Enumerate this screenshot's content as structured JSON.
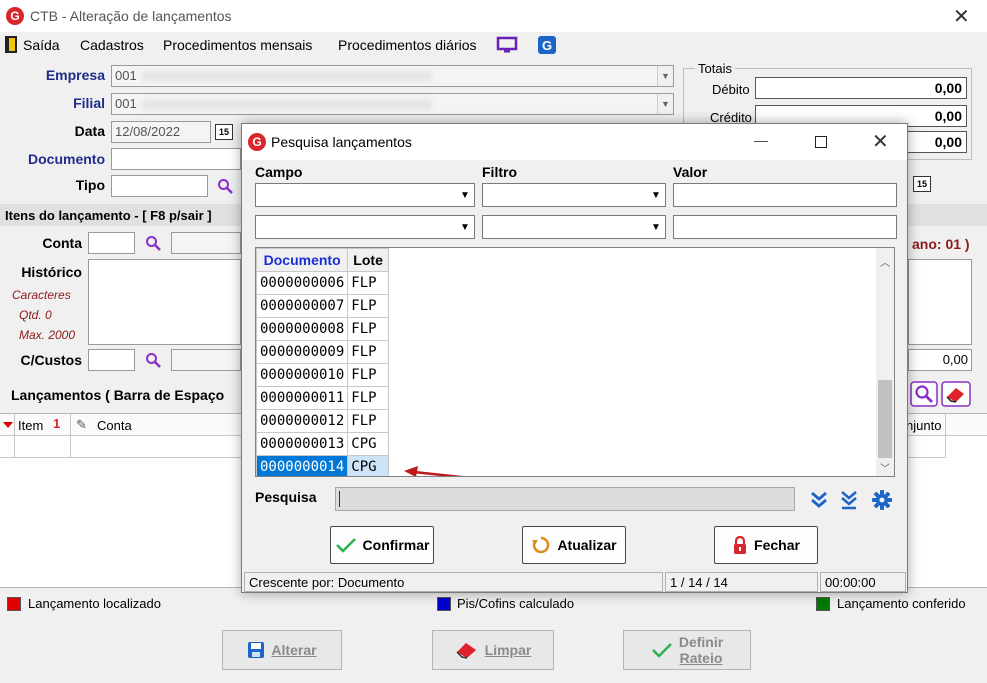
{
  "window": {
    "title": "CTB - Alteração de lançamentos",
    "close": "✕"
  },
  "menu": {
    "exit": "Saída",
    "items": [
      "Cadastros",
      "Procedimentos mensais",
      "Procedimentos diários"
    ]
  },
  "form": {
    "empresa_label": "Empresa",
    "empresa_value": "001",
    "filial_label": "Filial",
    "filial_value": "001",
    "data_label": "Data",
    "data_value": "12/08/2022",
    "documento_label": "Documento",
    "tipo_label": "Tipo",
    "calendar_icon_text": "15"
  },
  "totals": {
    "group_label": "Totais",
    "debito_label": "Débito",
    "debito_value": "0,00",
    "credito_label": "Crédito",
    "credito_value": "0,00",
    "third_value": "0,00"
  },
  "items_section": {
    "title": "Itens do lançamento - [ F8 p/sair ]",
    "conta_label": "Conta",
    "historico_label": "Histórico",
    "caracteres": "Caracteres",
    "qtd": "Qtd. 0",
    "max": "Max. 2000",
    "ccustos_label": "C/Custos",
    "right_red": "ano: 01 )",
    "right_value": "0,00"
  },
  "lancamentos": {
    "title": "Lançamentos ( Barra de Espaço",
    "col_item": "Item",
    "col_item_marker": "1",
    "col_conta": "Conta",
    "col_right": "njunto"
  },
  "legend": [
    {
      "label": "Lançamento localizado",
      "color": "#e00000"
    },
    {
      "label": "Pis/Cofins calculado",
      "color": "#0000d0"
    },
    {
      "label": "Lançamento conferido",
      "color": "#007a00"
    }
  ],
  "bottom_buttons": {
    "alterar": "Alterar",
    "limpar": "Limpar",
    "definir": "Definir",
    "rateio": "Rateio"
  },
  "dialog": {
    "title": "Pesquisa lançamentos",
    "minimize": "—",
    "maximize": "☐",
    "close": "✕",
    "campo_label": "Campo",
    "filtro_label": "Filtro",
    "valor_label": "Valor",
    "grid_headers": {
      "documento": "Documento",
      "lote": "Lote"
    },
    "rows": [
      {
        "documento": "0000000006",
        "lote": "FLP"
      },
      {
        "documento": "0000000007",
        "lote": "FLP"
      },
      {
        "documento": "0000000008",
        "lote": "FLP"
      },
      {
        "documento": "0000000009",
        "lote": "FLP"
      },
      {
        "documento": "0000000010",
        "lote": "FLP"
      },
      {
        "documento": "0000000011",
        "lote": "FLP"
      },
      {
        "documento": "0000000012",
        "lote": "FLP"
      },
      {
        "documento": "0000000013",
        "lote": "CPG"
      },
      {
        "documento": "0000000014",
        "lote": "CPG"
      }
    ],
    "selected_index": 8,
    "pesquisa_label": "Pesquisa",
    "buttons": {
      "confirmar": "Confirmar",
      "atualizar": "Atualizar",
      "fechar": "Fechar"
    },
    "status": {
      "order": "Crescente por: Documento",
      "position": "1 / 14 / 14",
      "time": "00:00:00"
    }
  },
  "colors": {
    "accent_red": "#d9262c",
    "selected_row": "#0078d7",
    "header_blue": "#1a2fd6",
    "icon_blue": "#1c64c8",
    "dark_red_label": "#8b1a1a"
  }
}
